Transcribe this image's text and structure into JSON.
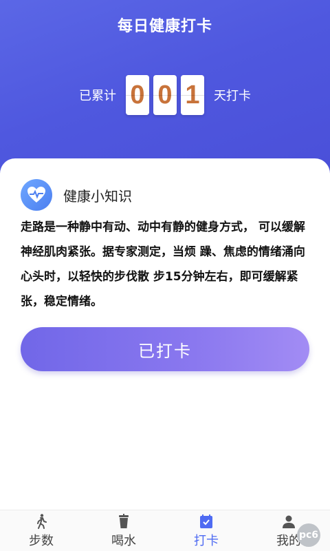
{
  "header": {
    "title": "每日健康打卡",
    "counter_prefix": "已累计",
    "counter_suffix": "天打卡",
    "digits": [
      "0",
      "0",
      "1"
    ]
  },
  "tip": {
    "title": "健康小知识",
    "body": "走路是一种静中有动、动中有静的健身方式， 可以缓解神经肌肉紧张。据专家测定，当烦 躁、焦虑的情绪涌向心头时，以轻快的步伐散 步15分钟左右，即可缓解紧张，稳定情绪。"
  },
  "checkin_button": {
    "label": "已打卡"
  },
  "tabs": [
    {
      "label": "步数",
      "icon": "walking-icon"
    },
    {
      "label": "喝水",
      "icon": "cup-icon"
    },
    {
      "label": "打卡",
      "icon": "calendar-check-icon",
      "active": true
    },
    {
      "label": "我的",
      "icon": "user-icon"
    }
  ],
  "watermark": {
    "text": "pc6"
  },
  "colors": {
    "header_bg": "#5b67e6",
    "digit_color": "#c8733a",
    "button_start": "#7167e8",
    "button_end": "#a28cf4",
    "active_tab": "#4f6bf2"
  }
}
